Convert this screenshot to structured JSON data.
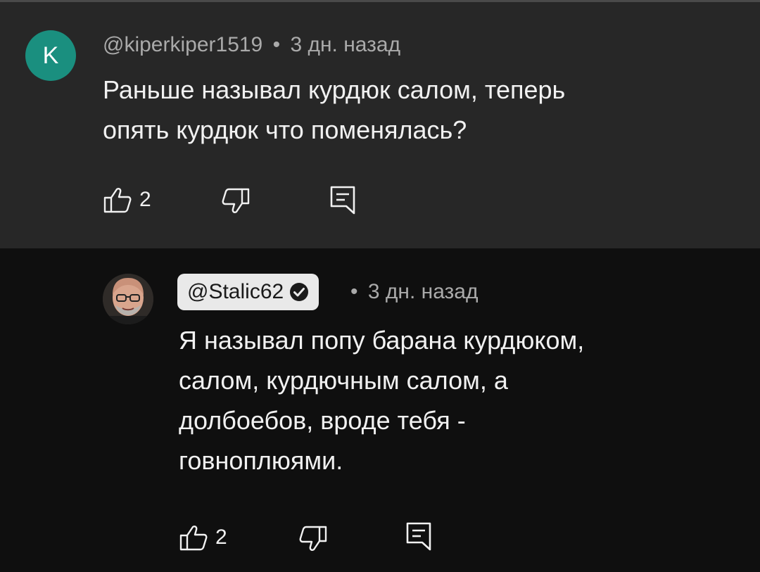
{
  "comments": [
    {
      "avatar_letter": "K",
      "avatar_color": "#1a8f7f",
      "author": "@kiperkiper1519",
      "separator": "•",
      "time": "3 дн. назад",
      "text_lines": [
        "Раньше называл курдюк салом, теперь",
        "опять курдюк что поменялась?"
      ],
      "likes": "2",
      "actions": [
        "like-icon",
        "dislike-icon",
        "reply-icon"
      ]
    },
    {
      "author": "@Stalic62",
      "verified": true,
      "separator": "•",
      "time": "3 дн. назад",
      "text_lines": [
        "Я называл попу барана курдюком,",
        "салом, курдючным салом, а",
        "долбоебов, вроде тебя -",
        "говноплюями."
      ],
      "likes": "2",
      "actions": [
        "like-icon",
        "dislike-icon",
        "reply-icon"
      ]
    }
  ],
  "colors": {
    "top_background": "#272727",
    "reply_background": "#0f0f0f",
    "meta_text": "#aaaaaa",
    "body_text": "#f1f1f1",
    "author_chip_background": "#e9e9e9"
  }
}
